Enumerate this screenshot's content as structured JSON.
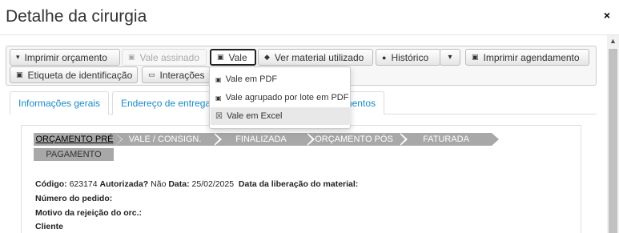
{
  "modal": {
    "title": "Detalhe da cirurgia",
    "close_glyph": "×"
  },
  "toolbar": {
    "imprimir_orcamento": "Imprimir orçamento",
    "vale_assinado": "Vale assinado",
    "vale": "Vale",
    "ver_material": "Ver material utilizado",
    "historico": "Histórico",
    "imprimir_agendamento": "Imprimir agendamento",
    "etiqueta": "Etiqueta de identificação",
    "interacoes": "Interações",
    "caret_glyph": "▾",
    "printer_glyph": "▣",
    "tag_glyph": "◆",
    "clock_glyph": "●",
    "chat_glyph": "▭"
  },
  "dropdown": {
    "items": [
      {
        "label": "Vale em PDF",
        "icon": "printer-icon",
        "glyph": "▣"
      },
      {
        "label": "Vale agrupado por lote em PDF",
        "icon": "printer-icon",
        "glyph": "▣"
      },
      {
        "label": "Vale em Excel",
        "icon": "excel-file-icon",
        "glyph": "☒"
      }
    ]
  },
  "tabs": [
    {
      "label": "Informações gerais"
    },
    {
      "label": "Endereço de entrega"
    },
    {
      "label": "mentos"
    }
  ],
  "steps": [
    "ORÇAMENTO PRÉ",
    "VALE / CONSIGN.",
    "FINALIZADA",
    "ORÇAMENTO PÓS",
    "FATURADA",
    "PAGAMENTO"
  ],
  "info": {
    "codigo_label": "Código:",
    "codigo_value": "623174",
    "autorizada_label": "Autorizada?",
    "autorizada_value": "Não",
    "data_label": "Data:",
    "data_value": "25/02/2025",
    "liberacao_label": "Data da liberação do material:",
    "pedido_label": "Número do pedido:",
    "motivo_label": "Motivo da rejeição do orc.:",
    "cliente_label": "Cliente"
  },
  "colors": {
    "link": "#1a8ac6",
    "step_bg": "#a8a8a8",
    "hover_bg": "#e8e8e8"
  }
}
